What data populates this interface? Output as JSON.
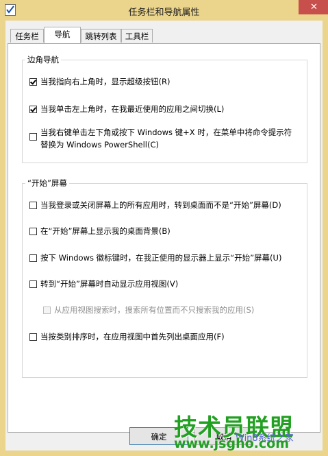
{
  "window": {
    "title": "任务栏和导航属性",
    "close_glyph": "✕"
  },
  "tabs": [
    {
      "label": "任务栏",
      "active": false
    },
    {
      "label": "导航",
      "active": true
    },
    {
      "label": "跳转列表",
      "active": false
    },
    {
      "label": "工具栏",
      "active": false
    }
  ],
  "corner_nav": {
    "legend": "边角导航",
    "options": [
      {
        "label": "当我指向右上角时，显示超级按钮(R)",
        "checked": true
      },
      {
        "label": "当我单击左上角时，在我最近使用的应用之间切换(L)",
        "checked": true
      },
      {
        "label_line1": "当我右键单击左下角或按下 Windows 键+X 时，在菜单中将命令提示符",
        "label_line2": "替换为 Windows PowerShell(C)",
        "checked": false
      }
    ]
  },
  "start_screen": {
    "legend": "“开始”屏幕",
    "options": [
      {
        "label": "当我登录或关闭屏幕上的所有应用时，转到桌面而不是“开始”屏幕(D)",
        "checked": false
      },
      {
        "label": "在“开始”屏幕上显示我的桌面背景(B)",
        "checked": false
      },
      {
        "label": "按下 Windows 徽标键时，在我正使用的显示器上显示“开始”屏幕(U)",
        "checked": false
      },
      {
        "label": "转到“开始”屏幕时自动显示应用视图(V)",
        "checked": false
      },
      {
        "label": "从应用视图搜索时，搜索所有位置而不只搜索我的应用(S)",
        "checked": false,
        "disabled": true
      },
      {
        "label": "当按类别排序时，在应用视图中首先列出桌面应用(F)",
        "checked": false
      }
    ]
  },
  "buttons": {
    "ok": "确定",
    "cancel": "取消"
  },
  "watermark": {
    "brand": "技术员联盟",
    "site": "www.jsgho.com",
    "small": "Win8系统之家"
  }
}
